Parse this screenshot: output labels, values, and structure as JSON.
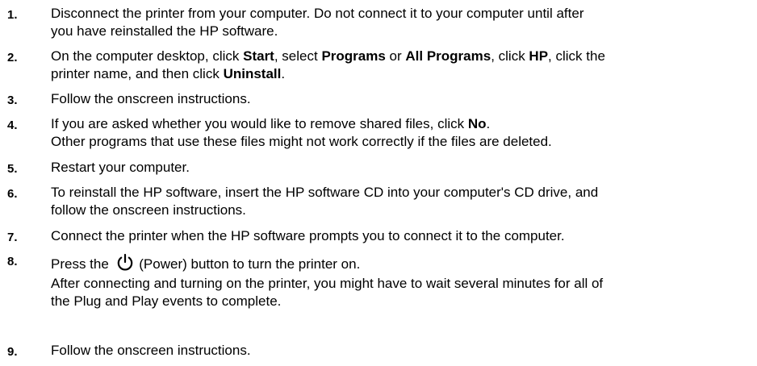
{
  "steps": [
    {
      "num": "1.",
      "line1": "Disconnect the printer from your computer. Do not connect it to your computer until after",
      "line2": "you have reinstalled the HP software."
    },
    {
      "num": "2.",
      "t1": "On the computer desktop, click ",
      "b1": "Start",
      "t2": ", select ",
      "b2": "Programs",
      "t3": " or ",
      "b3": "All Programs",
      "t4": ", click ",
      "b4": "HP",
      "t5": ", click the",
      "t6": "printer name, and then click ",
      "b5": "Uninstall",
      "t7": "."
    },
    {
      "num": "3.",
      "line1": "Follow the onscreen instructions."
    },
    {
      "num": "4.",
      "t1": "If you are asked whether you would like to remove shared files, click ",
      "b1": "No",
      "t2": ".",
      "line2": "Other programs that use these files might not work correctly if the files are deleted."
    },
    {
      "num": "5.",
      "line1": "Restart your computer."
    },
    {
      "num": "6.",
      "line1": "To reinstall the HP software, insert the HP software CD into your computer's CD drive, and",
      "line2": "follow the onscreen instructions."
    },
    {
      "num": "7.",
      "line1": "Connect the printer when the HP software prompts you to connect it to the computer."
    },
    {
      "num": "8.",
      "t1": "Press the ",
      "icon": "power-icon",
      "t2": " (Power) button to turn the printer on.",
      "line2": "After connecting and turning on the printer, you might have to wait several minutes for all of",
      "line3": "the Plug and Play events to complete."
    },
    {
      "num": "9.",
      "line1": "Follow the onscreen instructions."
    }
  ]
}
